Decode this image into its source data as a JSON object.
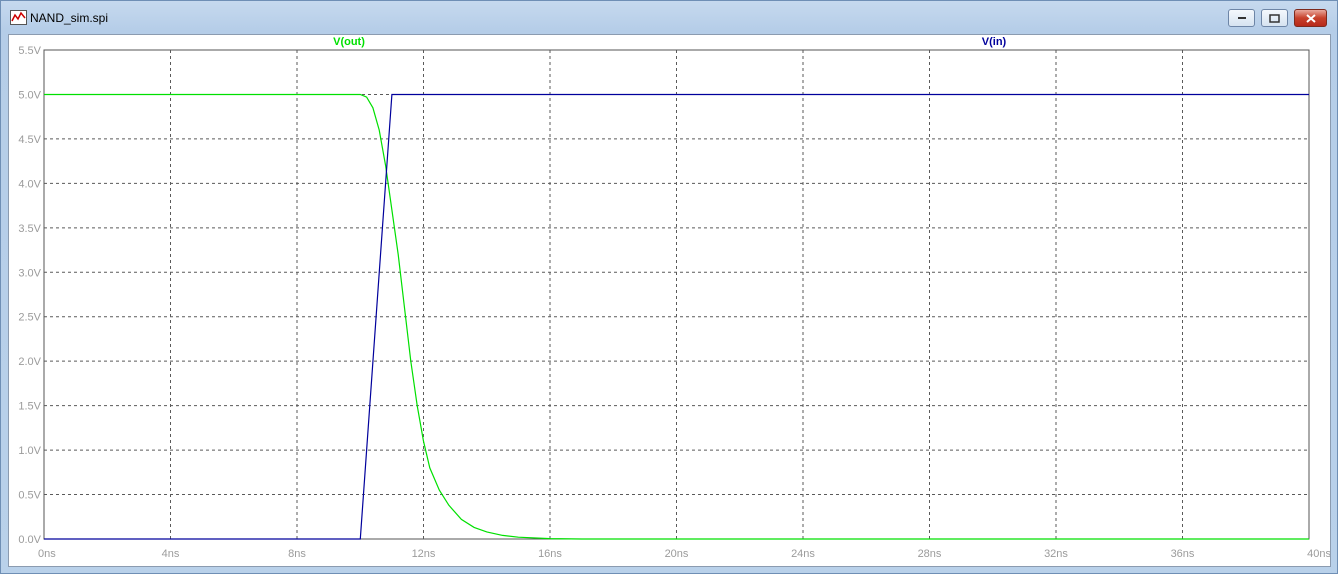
{
  "window": {
    "title": "NAND_sim.spi",
    "icon": "waveform-icon",
    "controls": [
      "minimize-icon",
      "maximize-icon",
      "close-icon"
    ]
  },
  "chart_data": {
    "type": "line",
    "xlabel": "",
    "ylabel": "",
    "xlim": [
      0,
      40
    ],
    "ylim": [
      0,
      5.5
    ],
    "x_ticks": [
      "0ns",
      "4ns",
      "8ns",
      "12ns",
      "16ns",
      "20ns",
      "24ns",
      "28ns",
      "32ns",
      "36ns",
      "40ns"
    ],
    "y_ticks": [
      "0.0V",
      "0.5V",
      "1.0V",
      "1.5V",
      "2.0V",
      "2.5V",
      "3.0V",
      "3.5V",
      "4.0V",
      "4.5V",
      "5.0V",
      "5.5V"
    ],
    "grid": true,
    "series": [
      {
        "name": "V(out)",
        "color": "#00e000",
        "x": [
          0,
          10.0,
          10.2,
          10.4,
          10.6,
          10.8,
          11.0,
          11.2,
          11.4,
          11.6,
          11.8,
          12.0,
          12.2,
          12.5,
          12.8,
          13.2,
          13.6,
          14.0,
          14.5,
          15.0,
          16.0,
          17.0,
          40
        ],
        "y": [
          5.0,
          5.0,
          4.97,
          4.85,
          4.6,
          4.2,
          3.7,
          3.2,
          2.6,
          2.0,
          1.5,
          1.1,
          0.8,
          0.55,
          0.38,
          0.22,
          0.13,
          0.08,
          0.04,
          0.02,
          0.005,
          0.0,
          0.0
        ]
      },
      {
        "name": "V(in)",
        "color": "#00009c",
        "x": [
          0,
          10.0,
          11.0,
          40
        ],
        "y": [
          0.0,
          0.0,
          5.0,
          5.0
        ]
      }
    ]
  }
}
